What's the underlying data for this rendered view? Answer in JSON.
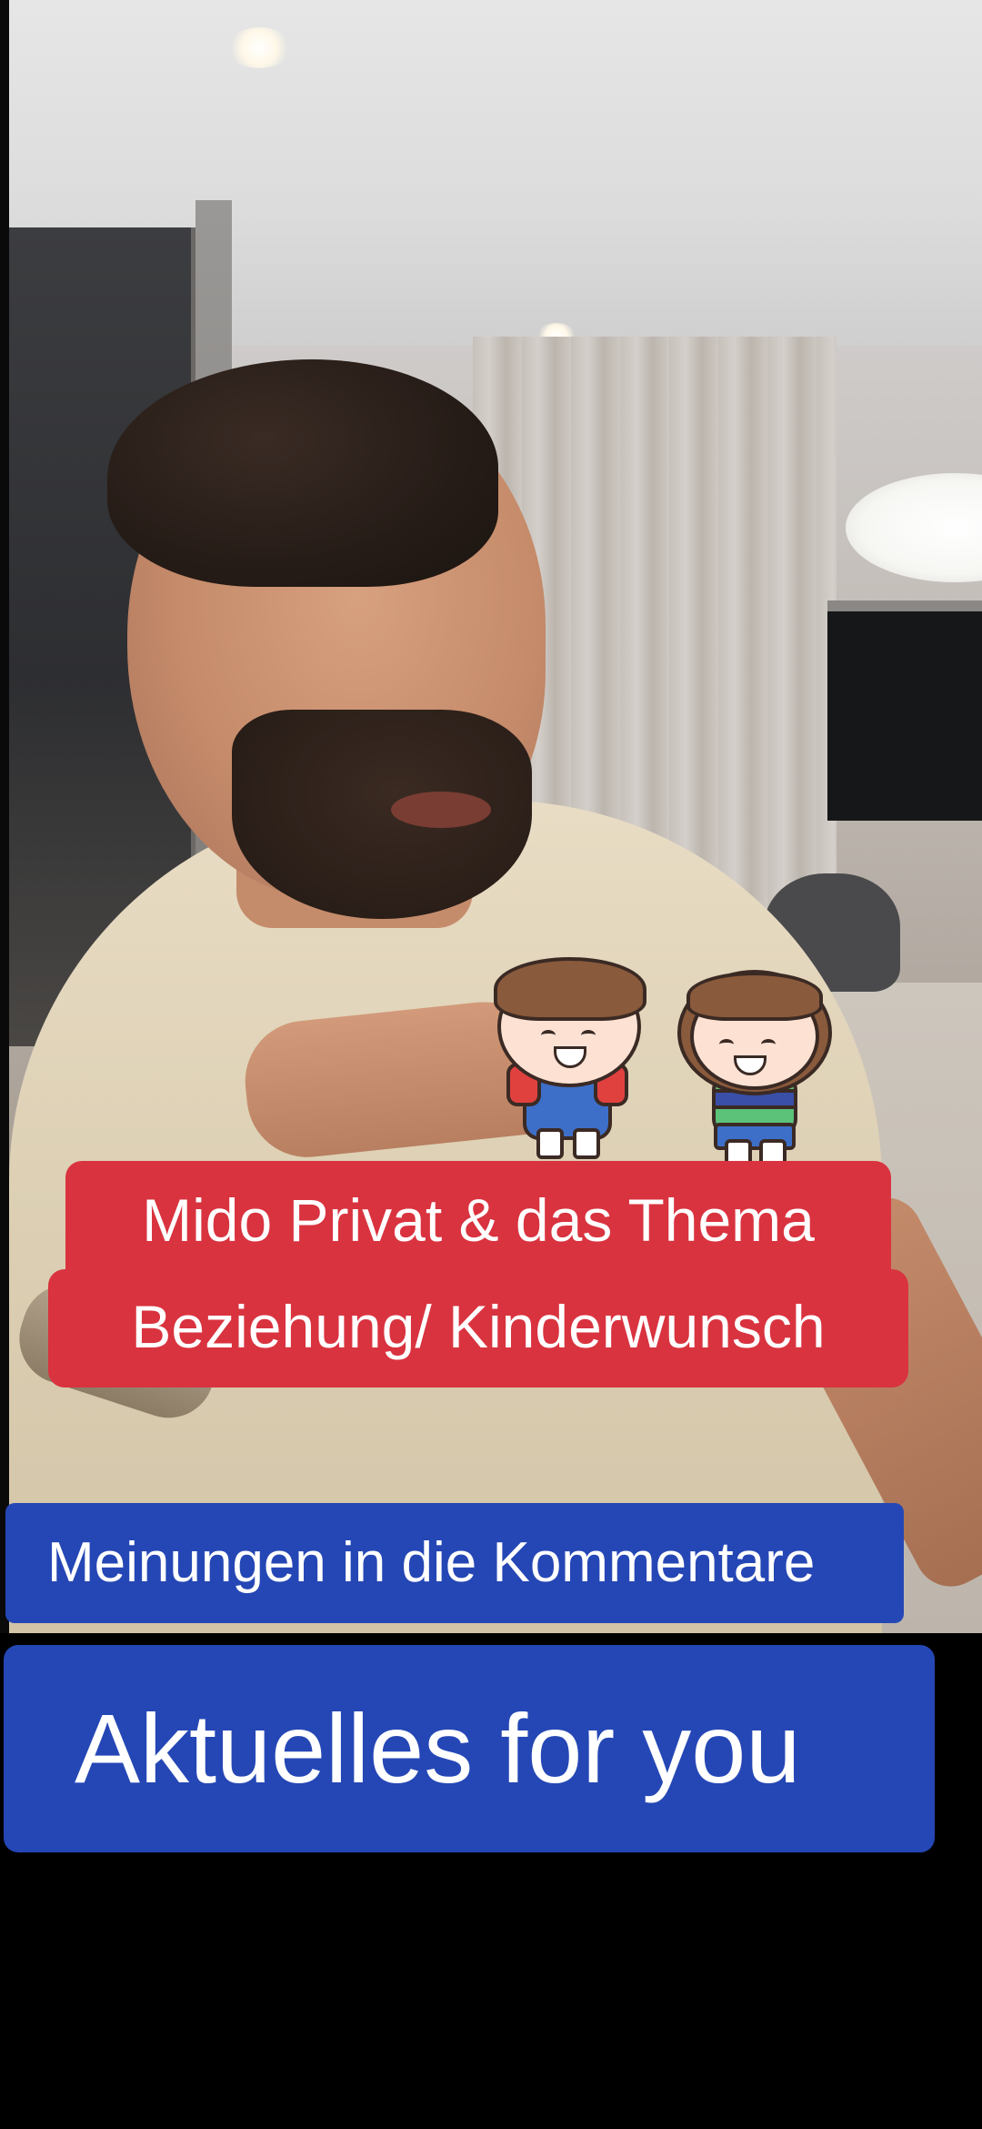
{
  "video": {
    "description_icon": "video-frame"
  },
  "captions": {
    "line1": "Mido Privat & das Thema",
    "line2": "Beziehung/ Kinderwunsch",
    "line3": "Meinungen in die Kommentare",
    "line4": "Aktuelles for you"
  },
  "colors": {
    "red_banner": "#d9333f",
    "blue_banner": "#2547b5",
    "text": "#ffffff",
    "background": "#000000"
  }
}
